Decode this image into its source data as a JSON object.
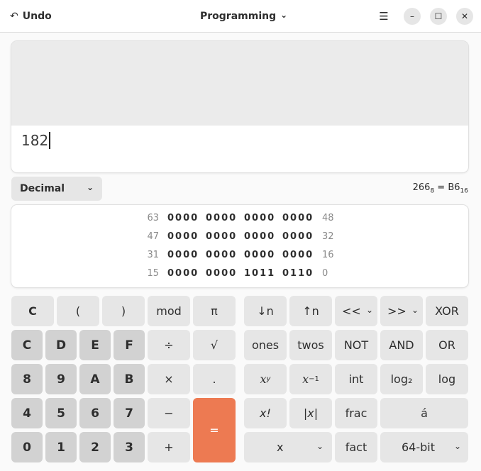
{
  "header": {
    "undo_icon": "↶",
    "undo_label": "Undo",
    "mode_label": "Programming",
    "mode_chevron": "⌄",
    "menu_icon": "☰",
    "minimize_icon": "–",
    "maximize_icon": "☐",
    "close_icon": "✕"
  },
  "display": {
    "entry": "182"
  },
  "base": {
    "selected": "Decimal",
    "chevron": "⌄"
  },
  "conversion": {
    "octal": "266",
    "octal_base": "8",
    "equals": " = ",
    "hex": "B6",
    "hex_base": "16"
  },
  "bits": {
    "rows": [
      {
        "left": "63",
        "nibbles": [
          "0000",
          "0000",
          "0000",
          "0000"
        ],
        "right": "48"
      },
      {
        "left": "47",
        "nibbles": [
          "0000",
          "0000",
          "0000",
          "0000"
        ],
        "right": "32"
      },
      {
        "left": "31",
        "nibbles": [
          "0000",
          "0000",
          "0000",
          "0000"
        ],
        "right": "16"
      },
      {
        "left": "15",
        "nibbles": [
          "0000",
          "0000",
          "1011",
          "0110"
        ],
        "right": "0"
      }
    ]
  },
  "keypad": {
    "clear": "C",
    "lparen": "(",
    "rparen": ")",
    "mod": "mod",
    "pi": "π",
    "hexC": "C",
    "hexD": "D",
    "hexE": "E",
    "hexF": "F",
    "divide": "÷",
    "sqrt": "√",
    "d8": "8",
    "d9": "9",
    "hexA": "A",
    "hexB": "B",
    "multiply": "×",
    "point": ".",
    "d4": "4",
    "d5": "5",
    "d6": "6",
    "d7": "7",
    "subtract": "−",
    "equals": "=",
    "d0": "0",
    "d1": "1",
    "d2": "2",
    "d3": "3",
    "add": "+"
  },
  "functions": {
    "shift_down": "↓n",
    "shift_up": "↑n",
    "shift_left": "<<",
    "shift_right": ">>",
    "xor": "XOR",
    "ones": "ones",
    "twos": "twos",
    "not": "NOT",
    "and": "AND",
    "or": "OR",
    "power_base": "x",
    "power_exp": "y",
    "inverse_base": "x",
    "inverse_exp": "−1",
    "int": "int",
    "log2": "log₂",
    "log": "log",
    "factorial": "x!",
    "abs": "|x|",
    "frac": "frac",
    "char": "á",
    "variable": "x",
    "fact": "fact",
    "wordsize": "64-bit",
    "chevron": "⌄"
  }
}
